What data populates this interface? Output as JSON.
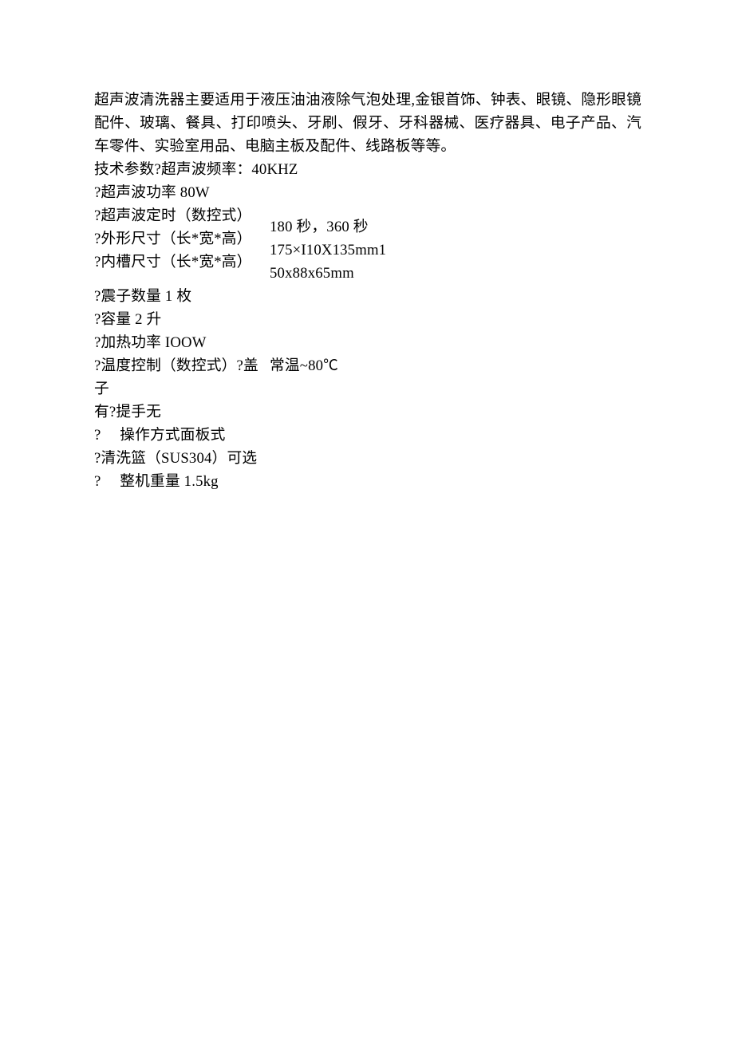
{
  "intro": "超声波清洗器主要适用于液压油油液除气泡处理,金银首饰、钟表、眼镜、隐形眼镜配件、玻璃、餐具、打印喷头、牙刷、假牙、牙科器械、医疗器具、电子产品、汽车零件、实验室用品、电脑主板及配件、线路板等等。",
  "spec_header": "技术参数?超声波频率：40KHZ",
  "power": "?超声波功率 80W",
  "block1_left": {
    "l1": "?超声波定时（数控式）",
    "l2": "?外形尺寸（长*宽*高）",
    "l3": "?内槽尺寸（长*宽*高）"
  },
  "block1_right": {
    "r1": "180 秒，360 秒",
    "r2": "175×I10X135mm1",
    "r3": "50x88x65mm"
  },
  "vibration": "?震子数量 1 枚",
  "capacity": "?容量 2 升",
  "heating": "?加热功率 IOOW",
  "temp_left": {
    "l1": "?温度控制（数控式）?盖子",
    "l2": "有?提手无"
  },
  "temp_right": "常温~80℃",
  "operation": "?　 操作方式面板式",
  "basket": "?清洗篮（SUS304）可选",
  "weight": "?　 整机重量 1.5kg"
}
